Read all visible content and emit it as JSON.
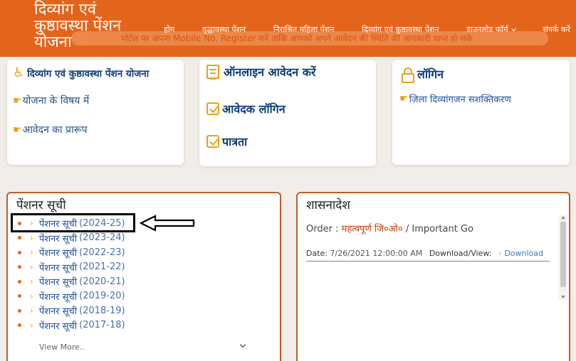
{
  "header": {
    "logo_lines": [
      "दिव्यांग एवं",
      "कुष्ठावस्था पेंशन",
      "योजना"
    ],
    "marquee_text": "पोर्टल पर अपना Mobile No. Register करें ताकि आपको अपने आवेदन की स्थिति की जानकारी प्राप्त हो सके",
    "nav": [
      {
        "label": "होम"
      },
      {
        "label": "वृद्धावस्था पेंशन"
      },
      {
        "label": "निराश्रित महिला पेंशन"
      },
      {
        "label": "दिव्यांग एवं कुष्ठावस्था पेंशन"
      },
      {
        "label": "डाउनलोड फॉर्म"
      },
      {
        "label": "संपर्क करें"
      }
    ]
  },
  "cards": {
    "left": {
      "title": "दिव्यांग एवं कुष्ठावस्था पेंशन योजना",
      "links": [
        "योजना के विषय में",
        "आवेदन का प्रारूप"
      ]
    },
    "middle": {
      "items": [
        "ऑनलाइन आवेदन करें",
        "आवेदक लॉगिन",
        "पात्रता"
      ]
    },
    "right": {
      "title": "लॉगिन",
      "links": [
        "ज़िला दिव्यांगजन सशक्तिकरण"
      ]
    }
  },
  "pensioner": {
    "title": "पेंशनर सूची",
    "items": [
      {
        "label": "पेंशनर सूची",
        "year": "(2024-25)"
      },
      {
        "label": "पेंशनर सूची",
        "year": "(2023-24)"
      },
      {
        "label": "पेंशनर सूची",
        "year": "(2022-23)"
      },
      {
        "label": "पेंशनर सूची",
        "year": "(2021-22)"
      },
      {
        "label": "पेंशनर सूची",
        "year": "(2020-21)"
      },
      {
        "label": "पेंशनर सूची",
        "year": "(2019-20)"
      },
      {
        "label": "पेंशनर सूची",
        "year": "(2018-19)"
      },
      {
        "label": "पेंशनर सूची",
        "year": "(2017-18)"
      }
    ],
    "view_more": "View More.."
  },
  "orders": {
    "title": "शासनादेश",
    "order_label": "Order :",
    "order_hi": "महत्वपूर्ण जि०ओ०",
    "order_en": "/ Important Go",
    "date_label": "Date:",
    "date_value": "7/26/2021 12:00:00 AM",
    "download_label": "Download/View:",
    "download_link": "Download"
  },
  "colors": {
    "header_bg": "#e3651b",
    "accent": "#e8a317",
    "panel_border": "#b9602a",
    "link": "#1f4c8f"
  }
}
